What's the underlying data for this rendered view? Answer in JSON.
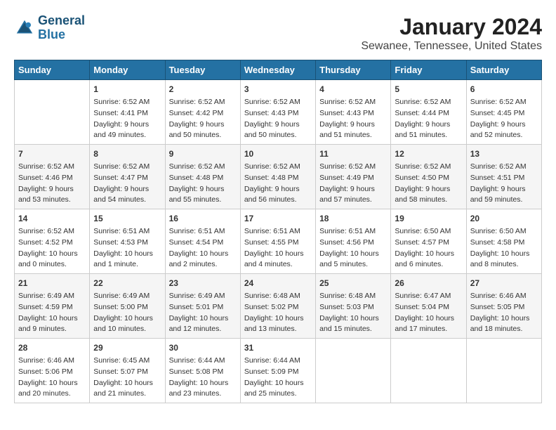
{
  "logo": {
    "line1": "General",
    "line2": "Blue"
  },
  "title": "January 2024",
  "subtitle": "Sewanee, Tennessee, United States",
  "headers": [
    "Sunday",
    "Monday",
    "Tuesday",
    "Wednesday",
    "Thursday",
    "Friday",
    "Saturday"
  ],
  "weeks": [
    [
      {
        "day": "",
        "content": ""
      },
      {
        "day": "1",
        "content": "Sunrise: 6:52 AM\nSunset: 4:41 PM\nDaylight: 9 hours\nand 49 minutes."
      },
      {
        "day": "2",
        "content": "Sunrise: 6:52 AM\nSunset: 4:42 PM\nDaylight: 9 hours\nand 50 minutes."
      },
      {
        "day": "3",
        "content": "Sunrise: 6:52 AM\nSunset: 4:43 PM\nDaylight: 9 hours\nand 50 minutes."
      },
      {
        "day": "4",
        "content": "Sunrise: 6:52 AM\nSunset: 4:43 PM\nDaylight: 9 hours\nand 51 minutes."
      },
      {
        "day": "5",
        "content": "Sunrise: 6:52 AM\nSunset: 4:44 PM\nDaylight: 9 hours\nand 51 minutes."
      },
      {
        "day": "6",
        "content": "Sunrise: 6:52 AM\nSunset: 4:45 PM\nDaylight: 9 hours\nand 52 minutes."
      }
    ],
    [
      {
        "day": "7",
        "content": "Sunrise: 6:52 AM\nSunset: 4:46 PM\nDaylight: 9 hours\nand 53 minutes."
      },
      {
        "day": "8",
        "content": "Sunrise: 6:52 AM\nSunset: 4:47 PM\nDaylight: 9 hours\nand 54 minutes."
      },
      {
        "day": "9",
        "content": "Sunrise: 6:52 AM\nSunset: 4:48 PM\nDaylight: 9 hours\nand 55 minutes."
      },
      {
        "day": "10",
        "content": "Sunrise: 6:52 AM\nSunset: 4:48 PM\nDaylight: 9 hours\nand 56 minutes."
      },
      {
        "day": "11",
        "content": "Sunrise: 6:52 AM\nSunset: 4:49 PM\nDaylight: 9 hours\nand 57 minutes."
      },
      {
        "day": "12",
        "content": "Sunrise: 6:52 AM\nSunset: 4:50 PM\nDaylight: 9 hours\nand 58 minutes."
      },
      {
        "day": "13",
        "content": "Sunrise: 6:52 AM\nSunset: 4:51 PM\nDaylight: 9 hours\nand 59 minutes."
      }
    ],
    [
      {
        "day": "14",
        "content": "Sunrise: 6:52 AM\nSunset: 4:52 PM\nDaylight: 10 hours\nand 0 minutes."
      },
      {
        "day": "15",
        "content": "Sunrise: 6:51 AM\nSunset: 4:53 PM\nDaylight: 10 hours\nand 1 minute."
      },
      {
        "day": "16",
        "content": "Sunrise: 6:51 AM\nSunset: 4:54 PM\nDaylight: 10 hours\nand 2 minutes."
      },
      {
        "day": "17",
        "content": "Sunrise: 6:51 AM\nSunset: 4:55 PM\nDaylight: 10 hours\nand 4 minutes."
      },
      {
        "day": "18",
        "content": "Sunrise: 6:51 AM\nSunset: 4:56 PM\nDaylight: 10 hours\nand 5 minutes."
      },
      {
        "day": "19",
        "content": "Sunrise: 6:50 AM\nSunset: 4:57 PM\nDaylight: 10 hours\nand 6 minutes."
      },
      {
        "day": "20",
        "content": "Sunrise: 6:50 AM\nSunset: 4:58 PM\nDaylight: 10 hours\nand 8 minutes."
      }
    ],
    [
      {
        "day": "21",
        "content": "Sunrise: 6:49 AM\nSunset: 4:59 PM\nDaylight: 10 hours\nand 9 minutes."
      },
      {
        "day": "22",
        "content": "Sunrise: 6:49 AM\nSunset: 5:00 PM\nDaylight: 10 hours\nand 10 minutes."
      },
      {
        "day": "23",
        "content": "Sunrise: 6:49 AM\nSunset: 5:01 PM\nDaylight: 10 hours\nand 12 minutes."
      },
      {
        "day": "24",
        "content": "Sunrise: 6:48 AM\nSunset: 5:02 PM\nDaylight: 10 hours\nand 13 minutes."
      },
      {
        "day": "25",
        "content": "Sunrise: 6:48 AM\nSunset: 5:03 PM\nDaylight: 10 hours\nand 15 minutes."
      },
      {
        "day": "26",
        "content": "Sunrise: 6:47 AM\nSunset: 5:04 PM\nDaylight: 10 hours\nand 17 minutes."
      },
      {
        "day": "27",
        "content": "Sunrise: 6:46 AM\nSunset: 5:05 PM\nDaylight: 10 hours\nand 18 minutes."
      }
    ],
    [
      {
        "day": "28",
        "content": "Sunrise: 6:46 AM\nSunset: 5:06 PM\nDaylight: 10 hours\nand 20 minutes."
      },
      {
        "day": "29",
        "content": "Sunrise: 6:45 AM\nSunset: 5:07 PM\nDaylight: 10 hours\nand 21 minutes."
      },
      {
        "day": "30",
        "content": "Sunrise: 6:44 AM\nSunset: 5:08 PM\nDaylight: 10 hours\nand 23 minutes."
      },
      {
        "day": "31",
        "content": "Sunrise: 6:44 AM\nSunset: 5:09 PM\nDaylight: 10 hours\nand 25 minutes."
      },
      {
        "day": "",
        "content": ""
      },
      {
        "day": "",
        "content": ""
      },
      {
        "day": "",
        "content": ""
      }
    ]
  ]
}
